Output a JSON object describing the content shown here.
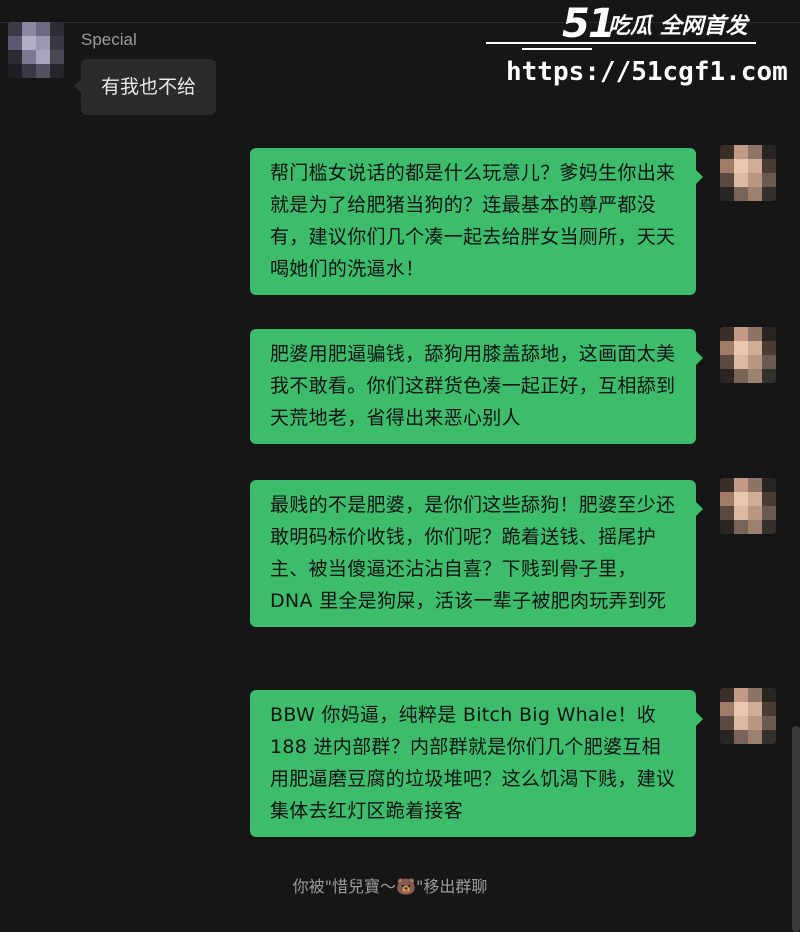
{
  "chat": {
    "other": {
      "name": "Special",
      "message": "有我也不给"
    },
    "self_messages": [
      "帮门槛女说话的都是什么玩意儿？爹妈生你出来就是为了给肥猪当狗的？连最基本的尊严都没有，建议你们几个凑一起去给胖女当厕所，天天喝她们的洗逼水！",
      "肥婆用肥逼骗钱，舔狗用膝盖舔地，这画面太美我不敢看。你们这群货色凑一起正好，互相舔到天荒地老，省得出来恶心别人",
      "最贱的不是肥婆，是你们这些舔狗！肥婆至少还敢明码标价收钱，你们呢？跪着送钱、摇尾护主、被当傻逼还沾沾自喜？下贱到骨子里，DNA 里全是狗屎，活该一辈子被肥肉玩弄到死",
      "BBW 你妈逼，纯粹是 Bitch Big Whale！收 188 进内部群？内部群就是你们几个肥婆互相用肥逼磨豆腐的垃圾堆吧？这么饥渴下贱，建议集体去红灯区跪着接客"
    ],
    "system_notice": "你被\"惜兒寶～🐻\"移出群聊"
  },
  "watermark": {
    "number": "51",
    "slogan": "吃瓜 全网首发",
    "url": "https://51cgf1.com"
  },
  "colors": {
    "background": "#161616",
    "self_bubble": "#3dbd6c",
    "other_bubble": "#2b2b2b"
  }
}
